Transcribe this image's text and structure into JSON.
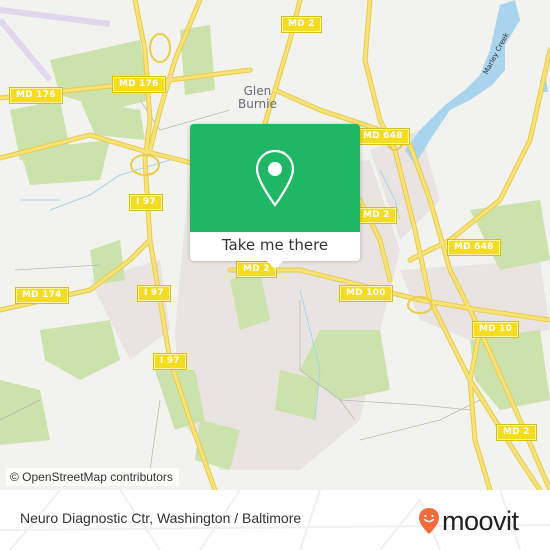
{
  "map": {
    "place_labels": [
      {
        "name": "glen-burnie-label",
        "text_line1": "Glen",
        "text_line2": "Burnie"
      }
    ],
    "water_labels": [
      {
        "name": "marley-creek-label",
        "text": "Marley Creek"
      }
    ],
    "road_shields": [
      {
        "id": "md176-west",
        "text": "MD 176"
      },
      {
        "id": "md176-east",
        "text": "MD 176"
      },
      {
        "id": "md2-north",
        "text": "MD 2"
      },
      {
        "id": "md648-north",
        "text": "MD 648"
      },
      {
        "id": "i97-north",
        "text": "I 97"
      },
      {
        "id": "md2-mid",
        "text": "MD 2"
      },
      {
        "id": "md648-east",
        "text": "MD 648"
      },
      {
        "id": "md174",
        "text": "MD 174"
      },
      {
        "id": "i97-mid",
        "text": "I 97"
      },
      {
        "id": "md-under-popup",
        "text": "MD 2"
      },
      {
        "id": "md100",
        "text": "MD 100"
      },
      {
        "id": "md10",
        "text": "MD 10"
      },
      {
        "id": "i97-south",
        "text": "I 97"
      },
      {
        "id": "md2-south",
        "text": "MD 2"
      }
    ],
    "attribution": "© OpenStreetMap contributors",
    "colors": {
      "background": "#f2f2ee",
      "park": "#c8e0a8",
      "water": "#a8d4ee",
      "road": "#f5dc5a",
      "urban": "#e8e2e0"
    }
  },
  "popup": {
    "icon": "location-pin-icon",
    "button_label": "Take me there",
    "color": "#1fb765"
  },
  "footer": {
    "title": "Neuro Diagnostic Ctr, Washington / Baltimore",
    "logo_text": "moovit",
    "logo_color": "#f26b3a"
  }
}
